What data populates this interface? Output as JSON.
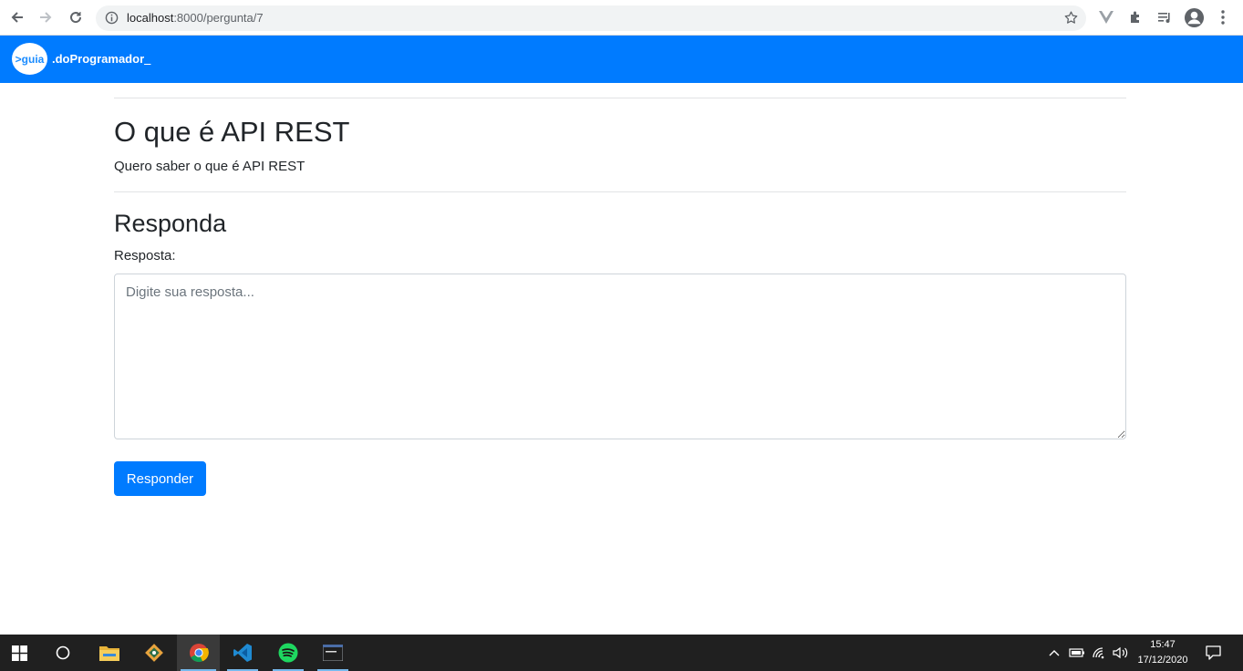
{
  "browser": {
    "url_host": "localhost",
    "url_path": ":8000/pergunta/7"
  },
  "site": {
    "logo_mark": ">guia",
    "logo_text": ".doProgramador",
    "logo_cursor": "_"
  },
  "question": {
    "title": "O que é API REST",
    "body": "Quero saber o que é API REST"
  },
  "reply": {
    "heading": "Responda",
    "label": "Resposta:",
    "placeholder": "Digite sua resposta...",
    "value": "",
    "submit_label": "Responder"
  },
  "taskbar": {
    "apps": [
      "start-icon",
      "cortana-icon",
      "file-explorer-icon",
      "git-icon",
      "chrome-icon",
      "vscode-icon",
      "spotify-icon",
      "terminal-icon"
    ],
    "active_app": "chrome-icon",
    "clock_time": "15:47",
    "clock_date": "17/12/2020"
  },
  "colors": {
    "primary": "#007bff",
    "taskbar": "#202020"
  }
}
